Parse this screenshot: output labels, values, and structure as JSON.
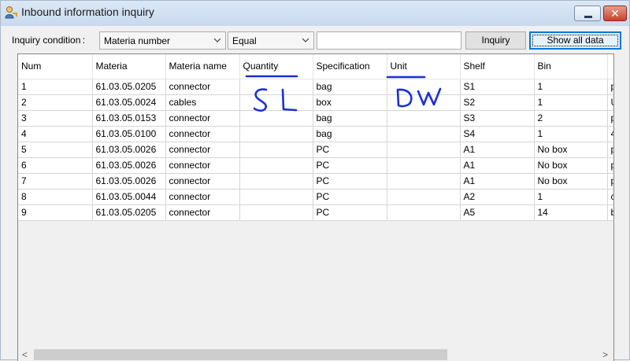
{
  "window": {
    "title": "Inbound information inquiry",
    "close_label": "✕"
  },
  "toolbar": {
    "condition_label": "Inquiry condition :",
    "field_value": "Materia number",
    "operator_value": "Equal",
    "search_value": "",
    "inquiry_label": "Inquiry",
    "show_all_label": "Show all data"
  },
  "table": {
    "columns": [
      "Num",
      "Materia",
      "Materia name",
      "Quantity",
      "Specification",
      "Unit",
      "Shelf",
      "Bin",
      ""
    ],
    "rows": [
      [
        "1",
        "61.03.05.0205",
        "connector",
        "",
        "bag",
        "",
        "S1",
        "1",
        "p"
      ],
      [
        "2",
        "61.03.05.0024",
        "cables",
        "",
        "box",
        "",
        "S2",
        "1",
        "U"
      ],
      [
        "3",
        "61.03.05.0153",
        "connector",
        "",
        "bag",
        "",
        "S3",
        "2",
        "p"
      ],
      [
        "4",
        "61.03.05.0100",
        "connector",
        "",
        "bag",
        "",
        "S4",
        "1",
        "4"
      ],
      [
        "5",
        "61.03.05.0026",
        "connector",
        "",
        "PC",
        "",
        "A1",
        "No box",
        "p"
      ],
      [
        "6",
        "61.03.05.0026",
        "connector",
        "",
        "PC",
        "",
        "A1",
        "No box",
        "p"
      ],
      [
        "7",
        "61.03.05.0026",
        "connector",
        "",
        "PC",
        "",
        "A1",
        "No box",
        "p"
      ],
      [
        "8",
        "61.03.05.0044",
        "connector",
        "",
        "PC",
        "",
        "A2",
        "1",
        "c"
      ],
      [
        "9",
        "61.03.05.0205",
        "connector",
        "",
        "PC",
        "",
        "A5",
        "14",
        "b"
      ]
    ]
  },
  "annotations": {
    "quantity_note": "SL",
    "unit_note": "DW",
    "ink_color": "#1a2fd6"
  },
  "icons": {
    "window": "user-key-icon",
    "minimize": "minimize-icon",
    "close": "close-icon",
    "dropdown": "chevron-down-icon",
    "scroll_left": "arrow-left-icon",
    "scroll_right": "arrow-right-icon"
  }
}
